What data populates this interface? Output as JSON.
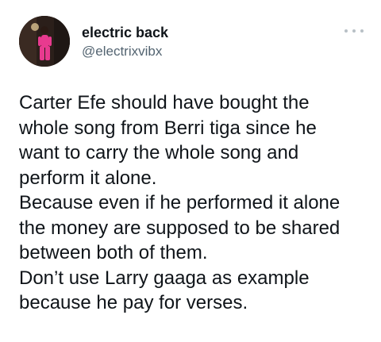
{
  "author": {
    "display_name": "electric back",
    "handle": "@electrixvibx"
  },
  "more_icon": "more-horizontal-icon",
  "tweet": {
    "lines": [
      "Carter Efe should have bought the",
      "whole song from Berri tiga since he",
      "want to carry the whole song and",
      "perform it alone.",
      "Because even if he performed it alone",
      "the money are supposed to be shared",
      "between both of them.",
      "Don’t use Larry gaaga as example",
      "because he pay for verses."
    ]
  }
}
